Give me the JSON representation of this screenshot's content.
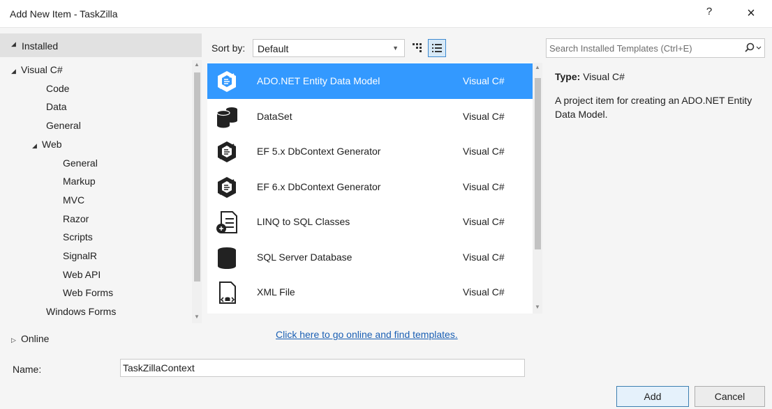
{
  "window": {
    "title": "Add New Item - TaskZilla",
    "help": "?",
    "close": "×"
  },
  "left": {
    "installed": "Installed",
    "tree": [
      {
        "label": "Visual C#",
        "level": 0,
        "expanded": true
      },
      {
        "label": "Code",
        "level": 1
      },
      {
        "label": "Data",
        "level": 1,
        "selected": true
      },
      {
        "label": "General",
        "level": 1
      },
      {
        "label": "Web",
        "level": 1,
        "expanded": true
      },
      {
        "label": "General",
        "level": 2
      },
      {
        "label": "Markup",
        "level": 2
      },
      {
        "label": "MVC",
        "level": 2
      },
      {
        "label": "Razor",
        "level": 2
      },
      {
        "label": "Scripts",
        "level": 2
      },
      {
        "label": "SignalR",
        "level": 2
      },
      {
        "label": "Web API",
        "level": 2
      },
      {
        "label": "Web Forms",
        "level": 2
      },
      {
        "label": "Windows Forms",
        "level": 1
      }
    ],
    "online": "Online"
  },
  "toolbar": {
    "sort_label": "Sort by:",
    "sort_value": "Default"
  },
  "templates": [
    {
      "name": "ADO.NET Entity Data Model",
      "lang": "Visual C#",
      "icon": "entity-model",
      "selected": true
    },
    {
      "name": "DataSet",
      "lang": "Visual C#",
      "icon": "dataset"
    },
    {
      "name": "EF 5.x DbContext Generator",
      "lang": "Visual C#",
      "icon": "entity-model"
    },
    {
      "name": "EF 6.x DbContext Generator",
      "lang": "Visual C#",
      "icon": "entity-model"
    },
    {
      "name": "LINQ to SQL Classes",
      "lang": "Visual C#",
      "icon": "linq-classes"
    },
    {
      "name": "SQL Server Database",
      "lang": "Visual C#",
      "icon": "database"
    },
    {
      "name": "XML File",
      "lang": "Visual C#",
      "icon": "xml-file"
    }
  ],
  "online_link": "Click here to go online and find templates.",
  "right": {
    "search_placeholder": "Search Installed Templates (Ctrl+E)",
    "type_label": "Type:",
    "type_value": "Visual C#",
    "description": "A project item for creating an ADO.NET Entity Data Model."
  },
  "bottom": {
    "name_label": "Name:",
    "name_value": "TaskZillaContext",
    "add": "Add",
    "cancel": "Cancel"
  },
  "colors": {
    "selection": "#3399ff",
    "link": "#1a5fb4",
    "accent_border": "#3c7fb1"
  }
}
